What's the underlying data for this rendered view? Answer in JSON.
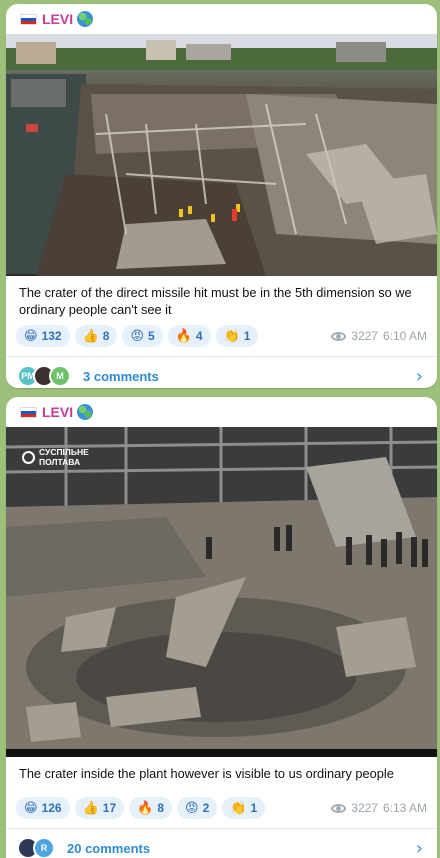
{
  "posts": [
    {
      "channel": "LEVI",
      "caption": "The crater of the direct missile hit must be in the 5th dimension so we ordinary people can't see it",
      "reactions": [
        {
          "emoji": "😁",
          "icon": "grin-icon",
          "count": "132"
        },
        {
          "emoji": "👍",
          "icon": "thumbs-up-icon",
          "count": "8"
        },
        {
          "emoji": "😡",
          "icon": "angry-face-icon",
          "count": "5"
        },
        {
          "emoji": "🔥",
          "icon": "fire-icon",
          "count": "4"
        },
        {
          "emoji": "👏",
          "icon": "clap-icon",
          "count": "1"
        }
      ],
      "views": "3227",
      "time": "6:10 AM",
      "comment_avatars": [
        {
          "initials": "PM",
          "color": "#56c2c5"
        },
        {
          "initials": "",
          "color": "#3a3030"
        },
        {
          "initials": "M",
          "color": "#6cc36a"
        }
      ],
      "comments_label": "3 comments"
    },
    {
      "channel": "LEVI",
      "caption": "The crater inside the plant however is visible to us ordinary people",
      "watermark": "СУСПІЛЬНЕ ПОЛТАВА",
      "reactions": [
        {
          "emoji": "😁",
          "icon": "grin-icon",
          "count": "126"
        },
        {
          "emoji": "👍",
          "icon": "thumbs-up-icon",
          "count": "17"
        },
        {
          "emoji": "🔥",
          "icon": "fire-icon",
          "count": "8"
        },
        {
          "emoji": "😡",
          "icon": "angry-face-icon",
          "count": "2"
        },
        {
          "emoji": "👏",
          "icon": "clap-icon",
          "count": "1"
        }
      ],
      "views": "3227",
      "time": "6:13 AM",
      "comment_avatars": [
        {
          "initials": "",
          "color": "#2d3a55"
        },
        {
          "initials": "R",
          "color": "#4fa3e0"
        }
      ],
      "comments_label": "20 comments"
    }
  ]
}
